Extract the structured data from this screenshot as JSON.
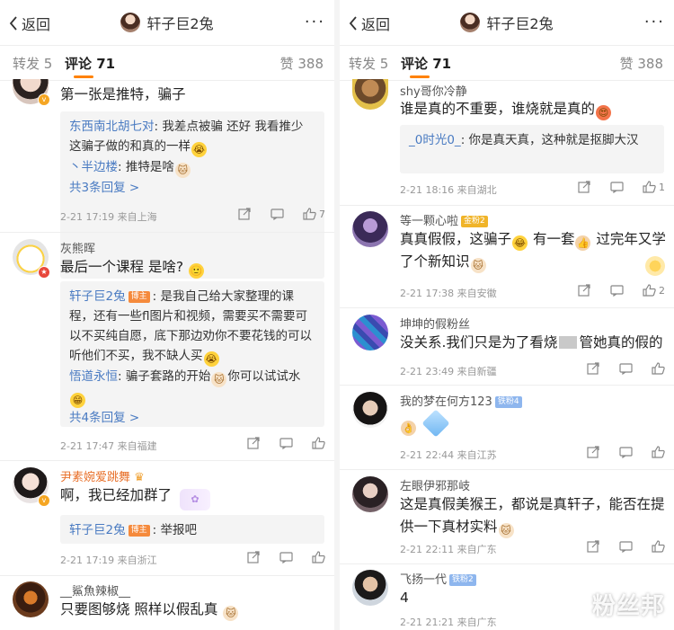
{
  "header": {
    "back_label": "返回",
    "title": "轩子巨2兔",
    "more_label": "···"
  },
  "tabs": {
    "repost": "转发 5",
    "comments": "评论 71",
    "likes": "赞 388"
  },
  "left": {
    "c1": {
      "text": "第一张是推特，骗子",
      "replies": [
        {
          "who": "东西南北胡七对",
          "text": ": 我差点被骗 还好 我看推少 这骗子做的和真的一样"
        },
        {
          "who": "丶半边楼",
          "text": ": 推特是啥"
        }
      ],
      "more": "共3条回复 >",
      "meta": "2-21 17:19 来自上海",
      "likes": "7"
    },
    "c2": {
      "user": "灰熊晖",
      "text": "最后一个课程 是啥?",
      "replies": [
        {
          "who": "轩子巨2兔",
          "tag": "博主",
          "text": ": 是我自己给大家整理的课程，还有一些fl图片和视频，需要买不需要可以不买纯自愿，底下那边劝你不要花钱的可以听他们不买，我不缺人买"
        },
        {
          "who": "悟道永恒",
          "text": ": 骗子套路的开始"
        }
      ],
      "reply2_tail": "你可以试试水",
      "more": "共4条回复 >",
      "meta": "2-21 17:47 来自福建"
    },
    "c3": {
      "user": "尹素婉爱跳舞",
      "text": "啊，我已经加群了",
      "replies": [
        {
          "who": "轩子巨2兔",
          "tag": "博主",
          "text": ": 举报吧"
        }
      ],
      "meta": "2-21 17:19 来自浙江"
    },
    "c4": {
      "user": "__鯊魚辣椒__",
      "text": "只要图够烧 照样以假乱真"
    }
  },
  "right": {
    "c1": {
      "user": "shy哥你冷静",
      "text": "谁是真的不重要，谁烧就是真的",
      "replies": [
        {
          "who": "_0时光0_",
          "text": ": 你是真天真，这种就是抠脚大汉"
        }
      ],
      "meta": "2-21 18:16 来自湖北",
      "likes": "1"
    },
    "c2": {
      "user": "等一颗心啦",
      "tag": "金粉2",
      "text": "真真假假，这骗子",
      "text_mid": "有一套",
      "text_tail": "过完年又学了个新知识",
      "meta": "2-21 17:38 来自安徽",
      "likes": "2"
    },
    "c3": {
      "user": "坤坤的假粉丝",
      "text": "没关系.我们只是为了看烧",
      "text_tail": "管她真的假的",
      "meta": "2-21 23:49 来自新疆"
    },
    "c4": {
      "user": "我的梦在何方123",
      "tag": "铁粉4",
      "meta": "2-21 22:44 来自江苏"
    },
    "c5": {
      "user": "左眼伊邪那岐",
      "text": "这是真假美猴王，都说是真轩子，能否在提供一下真材实料",
      "meta": "2-21 22:11 来自广东"
    },
    "c6": {
      "user": "飞扬一代",
      "tag": "铁粉2",
      "text": "4",
      "meta": "2-21 21:21 来自广东"
    }
  },
  "watermark": "粉丝邦",
  "colors": {
    "accent": "#ff8200",
    "link": "#4a7bc2",
    "reply_bg": "#f4f4f4"
  }
}
